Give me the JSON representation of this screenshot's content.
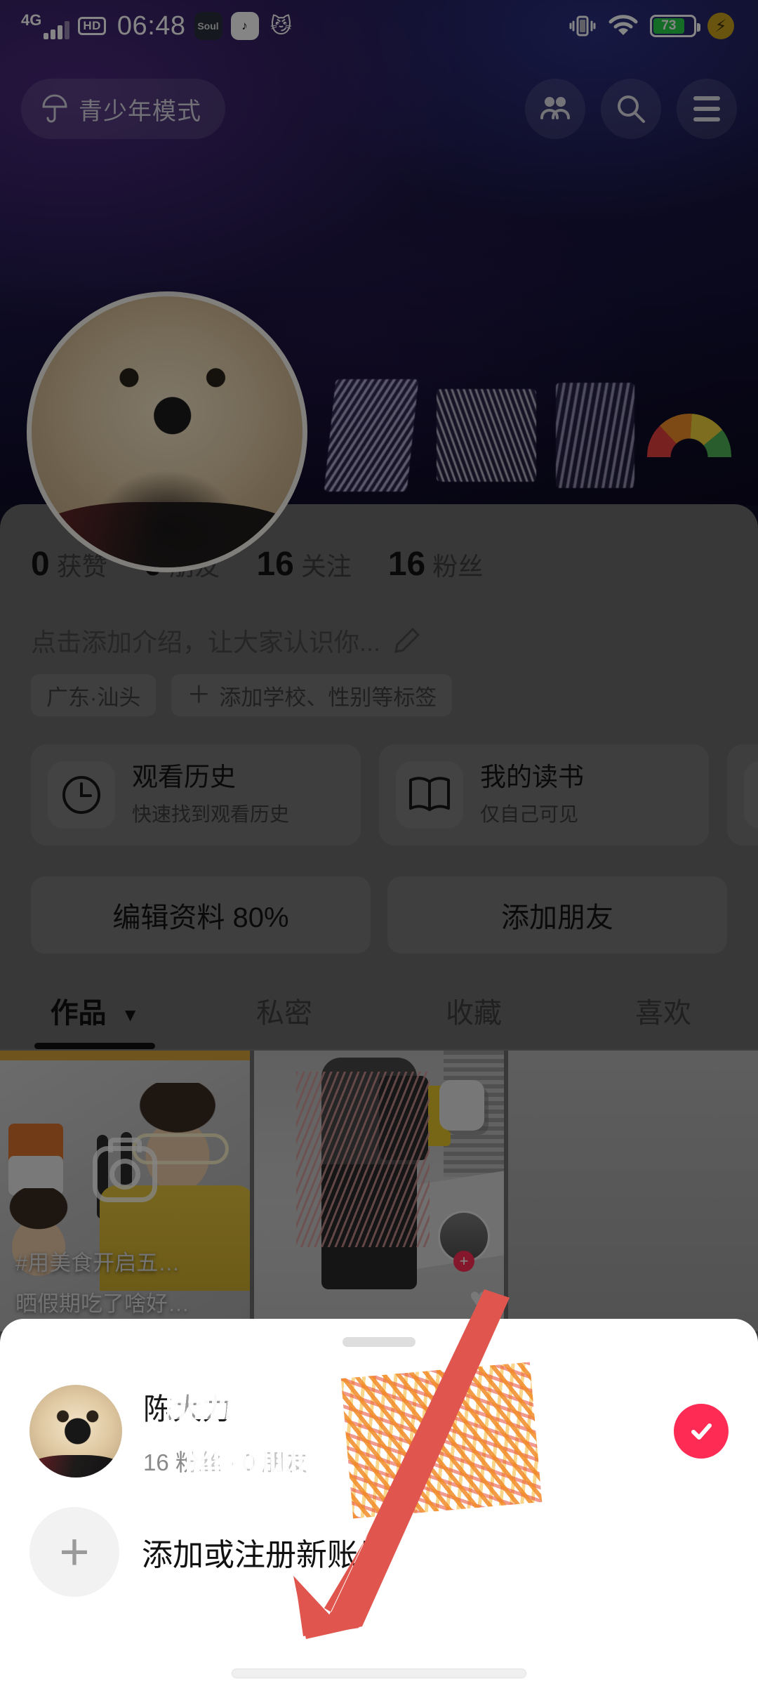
{
  "status_bar": {
    "network_type": "4G",
    "hd_label": "HD",
    "time": "06:48",
    "app_icons": [
      "soul-icon",
      "music-note-icon",
      "cat-icon"
    ],
    "vibrate_icon": "vibrate-icon",
    "wifi_icon": "wifi-icon",
    "battery_percent": "73",
    "fast_charge_icon": "flash-icon",
    "battery_color": "#27d04b"
  },
  "header": {
    "teen_mode_label": "青少年模式",
    "umbrella_icon": "umbrella-icon",
    "friends_icon": "friends-icon",
    "search_icon": "search-icon",
    "menu_icon": "hamburger-menu-icon"
  },
  "profile": {
    "avatar": "user-avatar-dog",
    "name_redacted": true,
    "rainbow_emoji": "rainbow-icon",
    "expand_icon": "chevron-down-icon",
    "stats": [
      {
        "num": "0",
        "label": "获赞"
      },
      {
        "num": "0",
        "label": "朋友"
      },
      {
        "num": "16",
        "label": "关注"
      },
      {
        "num": "16",
        "label": "粉丝"
      }
    ],
    "bio_placeholder": "点击添加介绍，让大家认识你...",
    "edit_icon": "pencil-icon",
    "tags": [
      {
        "text": "广东·汕头",
        "has_plus": false
      },
      {
        "text": "添加学校、性别等标签",
        "has_plus": true,
        "plus": "＋"
      }
    ],
    "action_cards": [
      {
        "icon": "clock-icon",
        "title": "观看历史",
        "subtitle": "快速找到观看历史"
      },
      {
        "icon": "book-icon",
        "title": "我的读书",
        "subtitle": "仅自己可见"
      },
      {
        "icon": "music-note-icon",
        "title": "",
        "subtitle": ""
      }
    ],
    "buttons": [
      {
        "label": "编辑资料 80%"
      },
      {
        "label": "添加朋友"
      }
    ],
    "tabs": [
      {
        "label": "作品",
        "caret": "▼",
        "active": true
      },
      {
        "label": "私密",
        "caret": "",
        "active": false
      },
      {
        "label": "收藏",
        "caret": "",
        "active": false
      },
      {
        "label": "喜欢",
        "caret": "",
        "active": false
      }
    ],
    "videos": [
      {
        "caption_line1": "#用美食开启五…",
        "caption_line2": "晒假期吃了啥好…",
        "overlay_icon": "camera-icon"
      },
      {
        "caption_line1": "",
        "caption_line2": "",
        "overlay_icon": "heart-icon"
      },
      {
        "caption_line1": "",
        "caption_line2": "",
        "overlay_icon": ""
      }
    ]
  },
  "sheet": {
    "handle": "drag-handle",
    "account": {
      "avatar": "account-avatar-dog",
      "name": "陈大力",
      "name_partially_erased": true,
      "meta": "16 粉丝 · 0 朋友",
      "selected": true,
      "check_icon": "check-circle-icon",
      "check_color": "#fe2c55"
    },
    "add_account": {
      "plus_icon": "plus-circle-icon",
      "label": "添加或注册新账号"
    }
  },
  "annotation": {
    "arrow_icon": "red-arrow-pointer",
    "arrow_color": "#e0564f"
  }
}
